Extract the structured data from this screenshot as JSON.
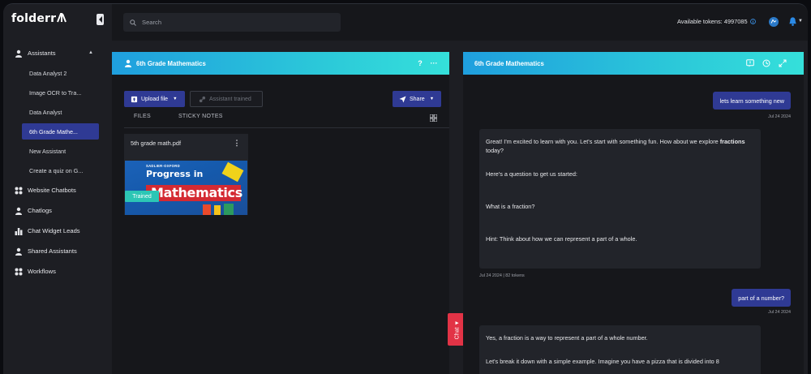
{
  "app": {
    "logo_text": "folderr"
  },
  "sidebar": {
    "items": [
      {
        "label": "Assistants",
        "icon": "assistant-icon"
      },
      {
        "label": "Website Chatbots",
        "icon": "chatbot-icon"
      },
      {
        "label": "Chatlogs",
        "icon": "chatlogs-icon"
      },
      {
        "label": "Chat Widget Leads",
        "icon": "bar-chart-icon"
      },
      {
        "label": "Shared Assistants",
        "icon": "shared-icon"
      },
      {
        "label": "Workflows",
        "icon": "workflow-icon"
      }
    ],
    "assistants": [
      "Data Analyst 2",
      "Image OCR to Tra...",
      "Data Analyst",
      "6th Grade Mathe...",
      "New Assistant",
      "Create a quiz on G..."
    ],
    "active_assistant_index": 3
  },
  "topbar": {
    "search_placeholder": "Search",
    "tokens_label": "Available tokens: 4997085"
  },
  "left_panel": {
    "title": "6th Grade Mathematics",
    "help_label": "?",
    "more_label": "···",
    "upload_label": "Upload file",
    "trained_label": "Assistant trained",
    "share_label": "Share",
    "tabs": [
      "FILES",
      "STICKY NOTES"
    ],
    "file": {
      "name": "5th grade math.pdf",
      "badge": "Trained",
      "cover_publisher": "SADLIER·OXFORD",
      "cover_line1": "Progress in",
      "cover_line2": "Mathematics"
    }
  },
  "chat_tab_label": "Chat",
  "right_panel": {
    "title": "6th Grade Mathematics",
    "messages": [
      {
        "role": "user",
        "text": "lets learn something new",
        "time": "Jul 24 2024"
      },
      {
        "role": "bot",
        "line1": "Great! I'm excited to learn with you. Let's start with something fun. How about we explore",
        "line1_bold": "fractions",
        "line1_tail": " today?",
        "line2": "Here's a question to get us started:",
        "line3": "What is a fraction?",
        "line4": "Hint: Think about how we can represent a part of a whole.",
        "time": "Jul 24 2024 | 82 tokens"
      },
      {
        "role": "user",
        "text": "part of a number?",
        "time": "Jul 24 2024"
      },
      {
        "role": "bot",
        "line1": "Yes, a fraction is a way to represent a part of a whole number.",
        "line2": "Let's break it down with a simple example. Imagine you have a pizza that is divided into 8"
      }
    ]
  },
  "colors": {
    "accent": "#2f3a94",
    "header_gradient_start": "#1f9fde",
    "header_gradient_end": "#35e0da",
    "trained_badge": "#2cc6b5",
    "chat_tab": "#e23346"
  }
}
